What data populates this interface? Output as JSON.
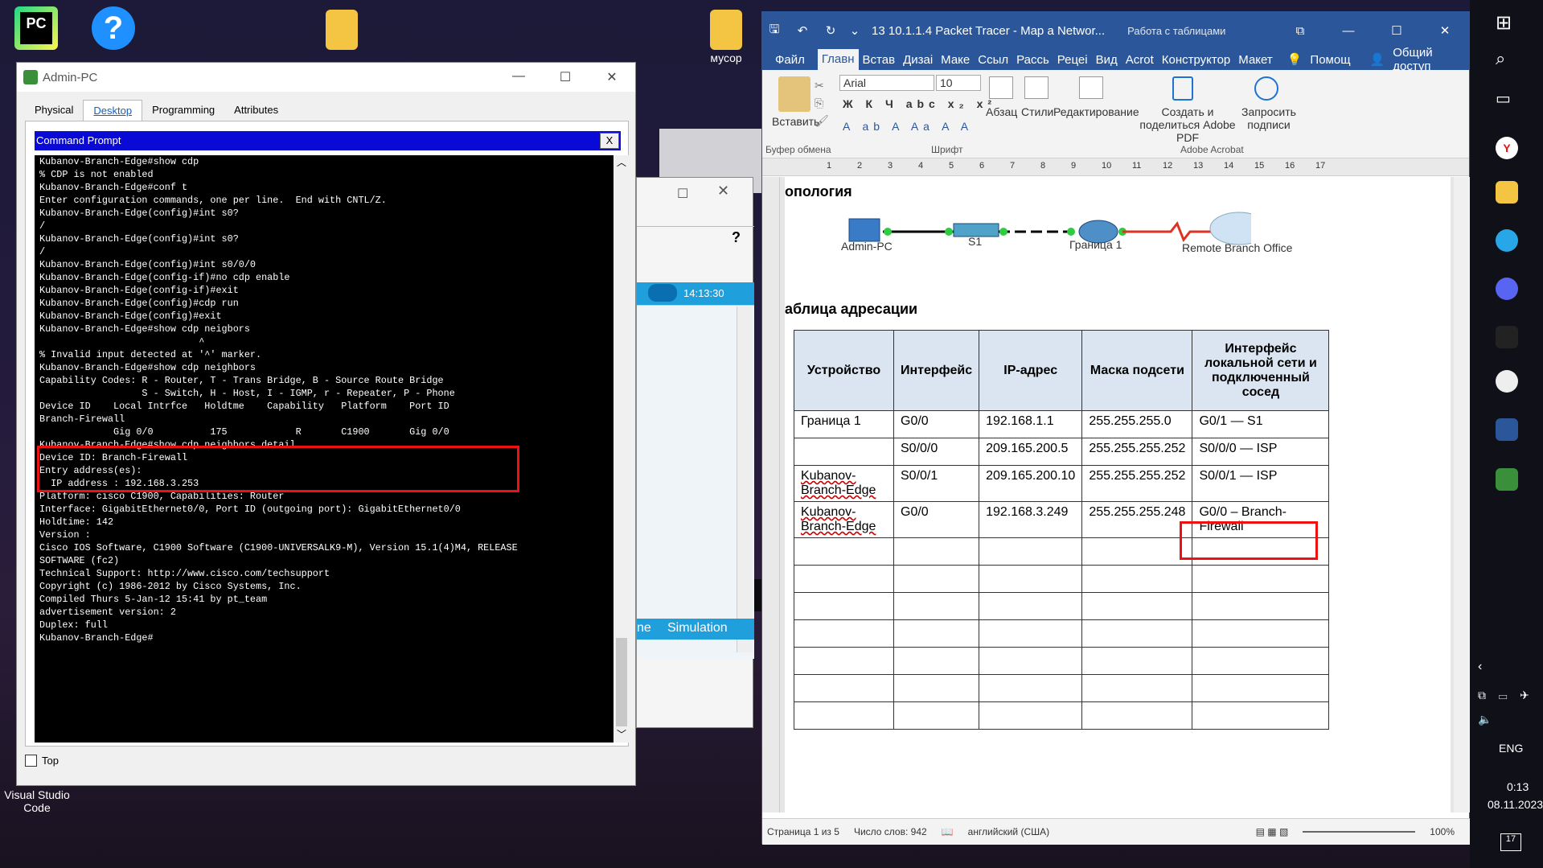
{
  "desktop": {
    "icons": [
      {
        "label": "",
        "name": "pycharm-icon"
      },
      {
        "label": "",
        "name": "help-icon"
      },
      {
        "label": "",
        "name": "folder-icon"
      },
      {
        "label": "мусор",
        "name": "folder-musor-icon"
      }
    ],
    "vscode_label_1": "Visual Studio",
    "vscode_label_2": "Code"
  },
  "pt_window": {
    "title": "Admin-PC",
    "tabs": [
      "Physical",
      "Desktop",
      "Programming",
      "Attributes"
    ],
    "selected_tab": "Desktop",
    "cmd_title": "Command Prompt",
    "cmd_close": "X",
    "top_checkbox_label": "Top",
    "terminal_lines": [
      "",
      "Kubanov-Branch-Edge#show cdp",
      "% CDP is not enabled",
      "Kubanov-Branch-Edge#conf t",
      "Enter configuration commands, one per line.  End with CNTL/Z.",
      "Kubanov-Branch-Edge(config)#int s0?",
      "/",
      "Kubanov-Branch-Edge(config)#int s0?",
      "/",
      "Kubanov-Branch-Edge(config)#int s0/0/0",
      "Kubanov-Branch-Edge(config-if)#no cdp enable",
      "Kubanov-Branch-Edge(config-if)#exit",
      "Kubanov-Branch-Edge(config)#cdp run",
      "Kubanov-Branch-Edge(config)#exit",
      "Kubanov-Branch-Edge#show cdp neigbors",
      "                            ^",
      "% Invalid input detected at '^' marker.",
      "",
      "Kubanov-Branch-Edge#show cdp neighbors",
      "Capability Codes: R - Router, T - Trans Bridge, B - Source Route Bridge",
      "                  S - Switch, H - Host, I - IGMP, r - Repeater, P - Phone",
      "Device ID    Local Intrfce   Holdtme    Capability   Platform    Port ID",
      "Branch-Firewall",
      "             Gig 0/0          175            R       C1900       Gig 0/0",
      "Kubanov-Branch-Edge#show cdp neighbors detail",
      "",
      "Device ID: Branch-Firewall",
      "Entry address(es):",
      "  IP address : 192.168.3.253",
      "Platform: cisco C1900, Capabilities: Router",
      "Interface: GigabitEthernet0/0, Port ID (outgoing port): GigabitEthernet0/0",
      "Holdtime: 142",
      "",
      "Version :",
      "Cisco IOS Software, C1900 Software (C1900-UNIVERSALK9-M), Version 15.1(4)M4, RELEASE",
      "SOFTWARE (fc2)",
      "Technical Support: http://www.cisco.com/techsupport",
      "Copyright (c) 1986-2012 by Cisco Systems, Inc.",
      "Compiled Thurs 5-Jan-12 15:41 by pt_team",
      "",
      "advertisement version: 2",
      "Duplex: full",
      "",
      "Kubanov-Branch-Edge#"
    ]
  },
  "pt_window2": {
    "question": "?",
    "time": "14:13:30",
    "realtime_label": "ne",
    "simulation_label": "Simulation"
  },
  "word": {
    "title": "13 10.1.1.4 Packet Tracer - Map a Networ...",
    "context_tab": "Работа с таблицами",
    "menu": [
      "Файл",
      "Главн",
      "Встав",
      "Дизаі",
      "Маке",
      "Ссыл",
      "Рассь",
      "Рецеі",
      "Вид",
      "Acrot",
      "Конструктор",
      "Макет"
    ],
    "help": "Помощ",
    "share": "Общий доступ",
    "ribbon": {
      "paste": "Вставить",
      "clipboard_group": "Буфер обмена",
      "font_name": "Arial",
      "font_size": "10",
      "font_group": "Шрифт",
      "paragraph": "Абзац",
      "styles": "Стили",
      "editing": "Редактирование",
      "create_pdf": "Создать и поделиться Adobe PDF",
      "request_sign": "Запросить подписи",
      "acrobat_group": "Adobe Acrobat"
    },
    "ruler_marks": [
      "1",
      "2",
      "3",
      "4",
      "5",
      "6",
      "7",
      "8",
      "9",
      "10",
      "11",
      "12",
      "13",
      "14",
      "15",
      "16",
      "17"
    ],
    "topology_heading": "опология",
    "topology_nodes": [
      "Admin-PC",
      "S1",
      "Граница 1",
      "Remote Branch Office"
    ],
    "table_heading": "аблица адресации",
    "table": {
      "headers": [
        "Устройство",
        "Интерфейс",
        "IP-адрес",
        "Маска подсети",
        "Интерфейс локальной сети и подключенный сосед"
      ],
      "rows": [
        [
          "Граница 1",
          "G0/0",
          "192.168.1.1",
          "255.255.255.0",
          "G0/1 — S1"
        ],
        [
          "",
          "S0/0/0",
          "209.165.200.5",
          "255.255.255.252",
          "S0/0/0 — ISP"
        ],
        [
          "Kubanov-Branch-Edge",
          "S0/0/1",
          "209.165.200.10",
          "255.255.255.252",
          "S0/0/1 — ISP"
        ],
        [
          "Kubanov-Branch-Edge",
          "G0/0",
          "192.168.3.249",
          "255.255.255.248",
          "G0/0 – Branch-Firewall"
        ]
      ],
      "empty_rows": 7
    },
    "status": {
      "page": "Страница 1 из 5",
      "words": "Число слов: 942",
      "language": "английский (США)",
      "zoom": "100%"
    }
  },
  "taskbar": {
    "language": "ENG",
    "time": "0:13",
    "date": "08.11.2023",
    "notifications": "17"
  }
}
